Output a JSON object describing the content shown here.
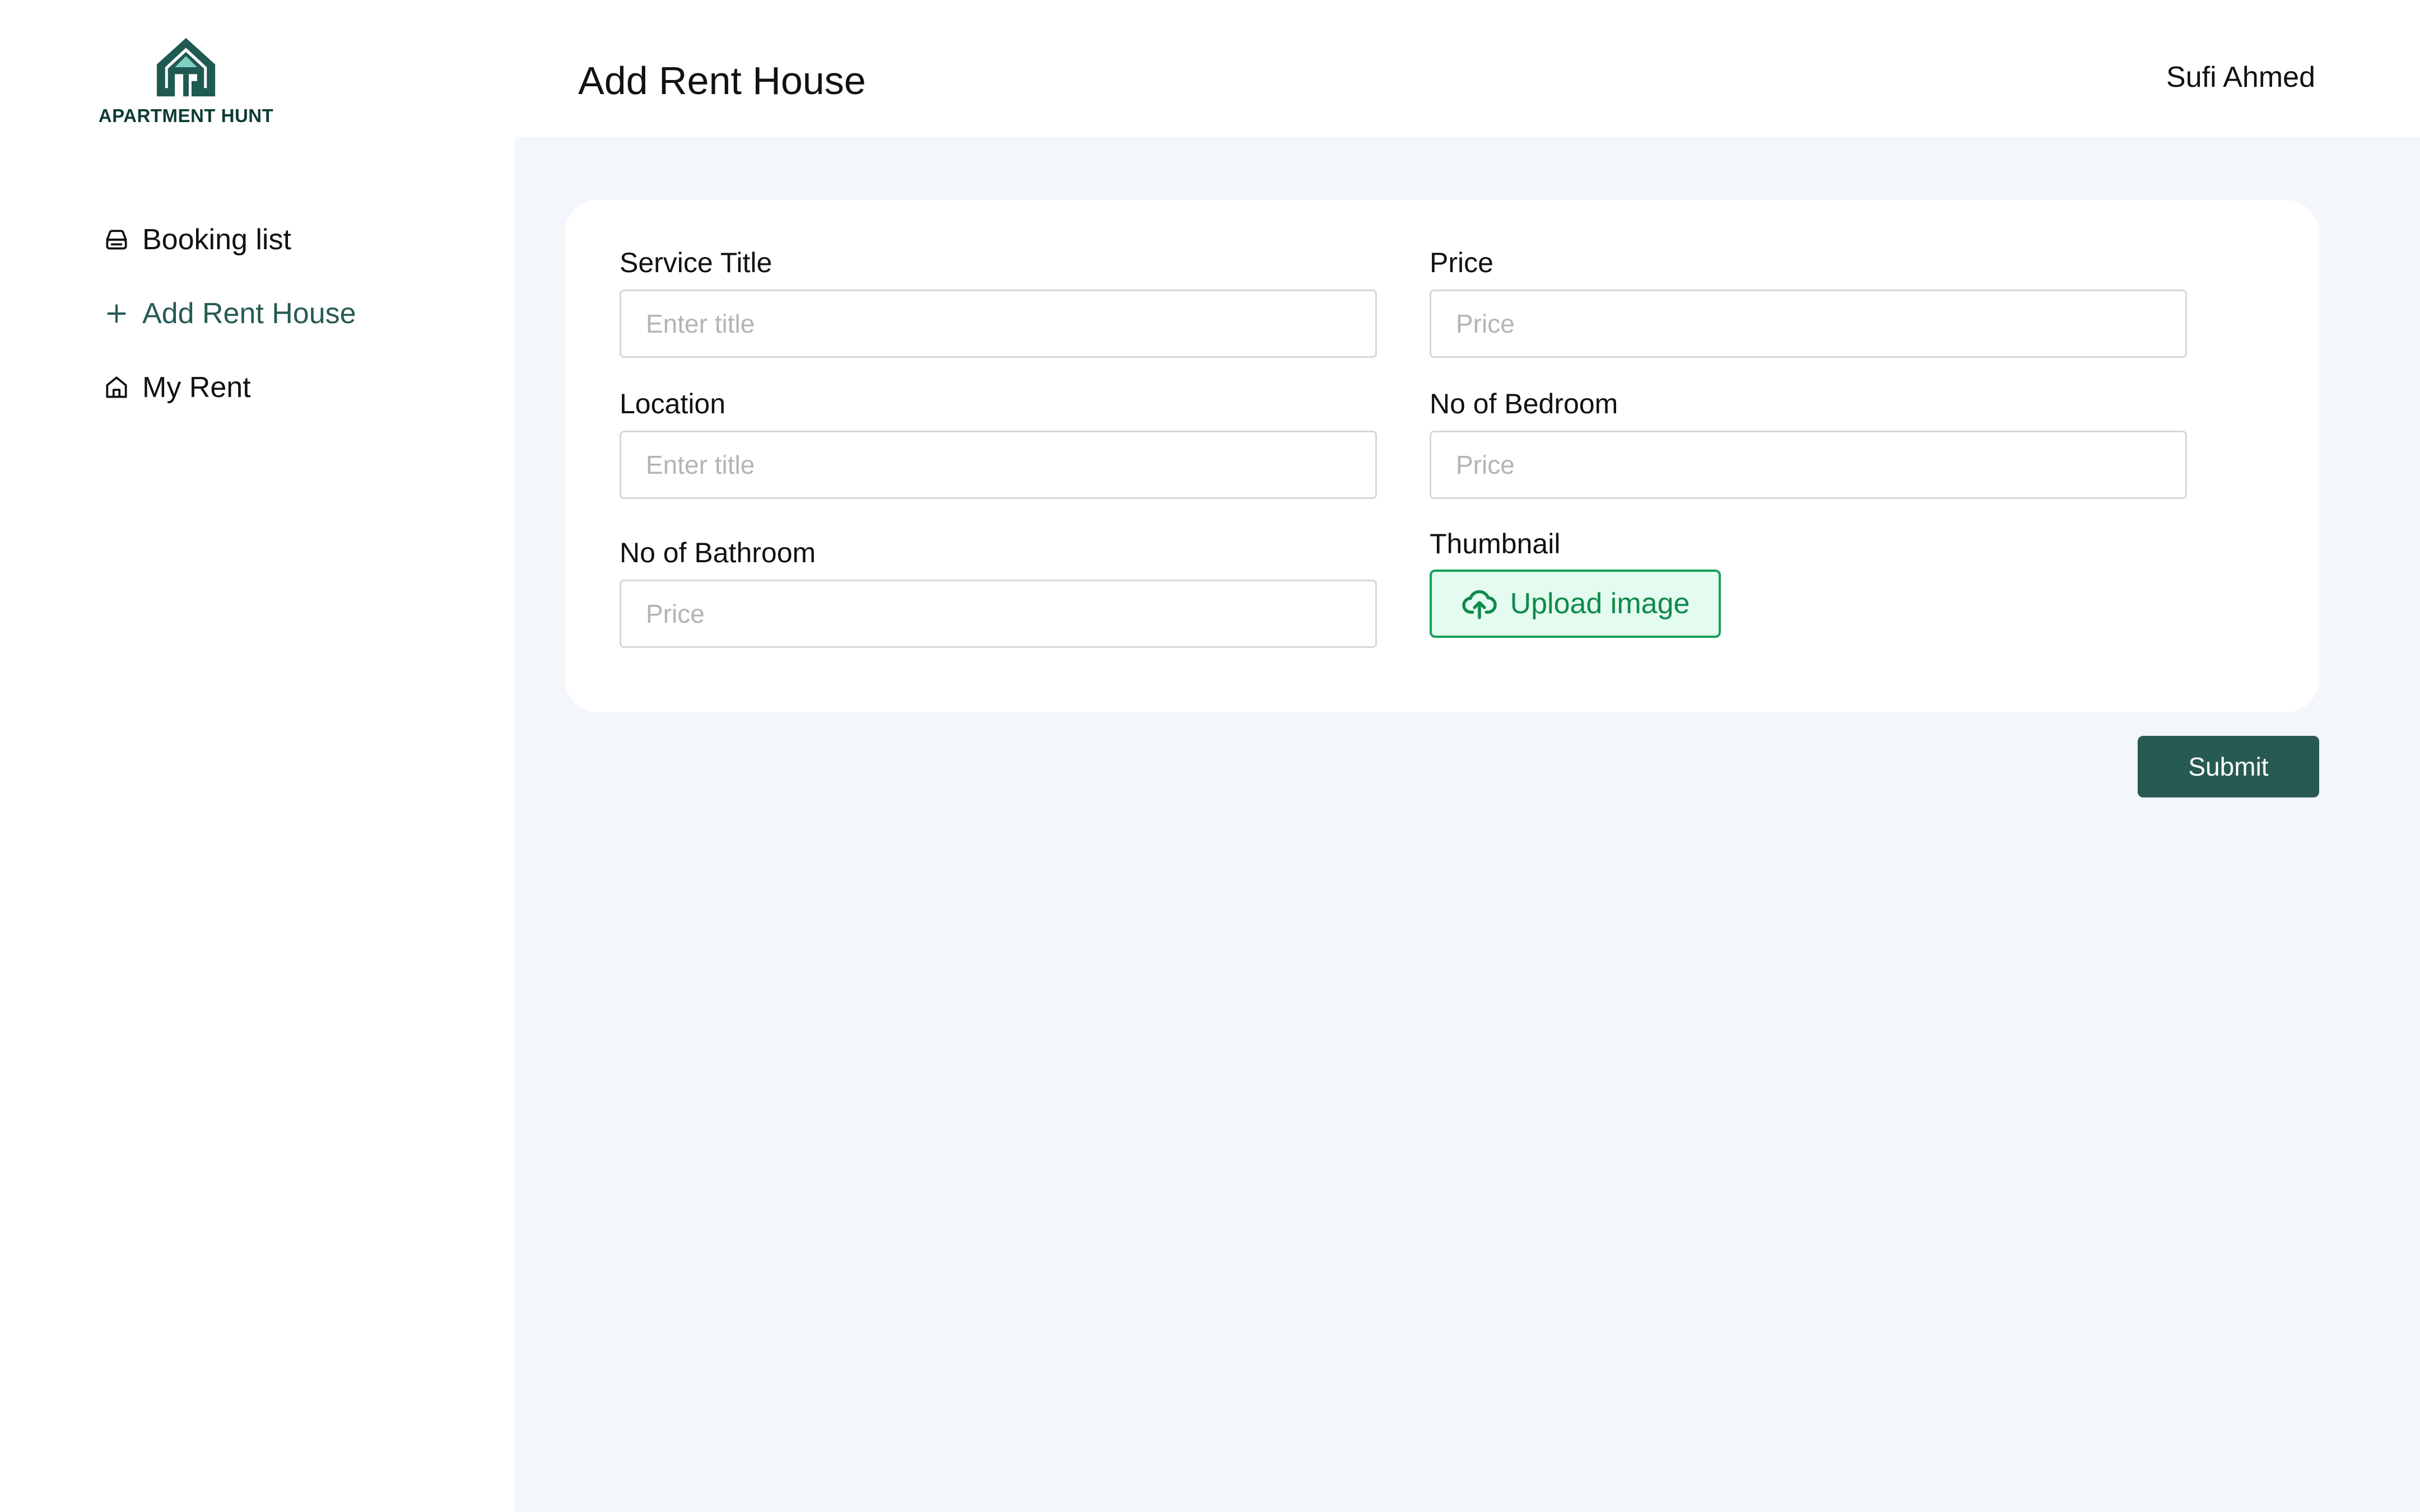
{
  "brand": {
    "name": "APARTMENT HUNT",
    "colors": {
      "primary": "#275a53",
      "logo_dark": "#1f5a52",
      "logo_accent": "#7fd1c3"
    }
  },
  "sidebar": {
    "items": [
      {
        "label": "Booking list",
        "icon": "inbox-icon",
        "active": false
      },
      {
        "label": "Add Rent House",
        "icon": "plus-icon",
        "active": true
      },
      {
        "label": "My Rent",
        "icon": "home-icon",
        "active": false
      }
    ]
  },
  "header": {
    "title": "Add Rent House",
    "user": "Sufi Ahmed"
  },
  "form": {
    "service_title": {
      "label": "Service Title",
      "placeholder": "Enter title",
      "value": ""
    },
    "price": {
      "label": "Price",
      "placeholder": "Price",
      "value": ""
    },
    "location": {
      "label": "Location",
      "placeholder": "Enter title",
      "value": ""
    },
    "bedroom": {
      "label": "No of Bedroom",
      "placeholder": "Price",
      "value": ""
    },
    "bathroom": {
      "label": "No of Bathroom",
      "placeholder": "Price",
      "value": ""
    },
    "thumbnail": {
      "label": "Thumbnail",
      "button_label": "Upload image",
      "icon": "upload-cloud-icon"
    },
    "submit_label": "Submit"
  }
}
